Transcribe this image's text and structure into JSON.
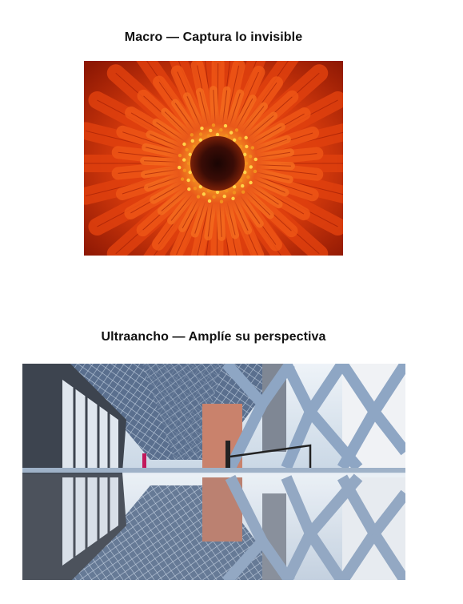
{
  "sections": [
    {
      "caption": "Macro — Captura lo invisible",
      "image_icon": "orange-gerbera-flower-macro-photo"
    },
    {
      "caption": "Ultraancho — Amplíe su perspectiva",
      "image_icon": "ultrawide-glass-building-reflection-photo"
    }
  ],
  "colors": {
    "flower_center": "#2a0a06",
    "flower_petal": "#e8430e",
    "flower_edge": "#a81e06",
    "building_sky": "#d7e4ef",
    "building_frame": "#8ea6c4"
  }
}
